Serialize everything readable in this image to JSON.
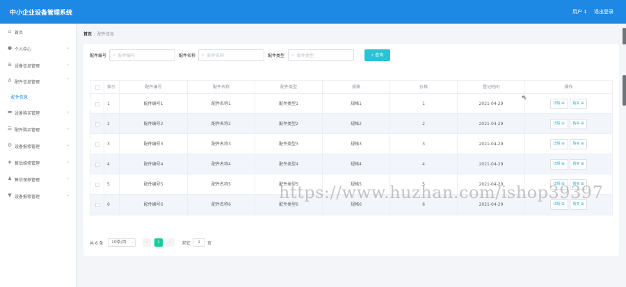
{
  "header": {
    "app_title": "中小企业设备管理系统",
    "user_label": "用户 1",
    "logout_label": "退出登录",
    "brand_color": "#1e88e5"
  },
  "sidebar": {
    "items": [
      {
        "label": "首页",
        "icon": "home-icon",
        "has_children": false
      },
      {
        "label": "个人中心",
        "icon": "user-icon",
        "has_children": true
      },
      {
        "label": "设备信息管理",
        "icon": "list-icon",
        "has_children": true
      },
      {
        "label": "配件信息管理",
        "icon": "bulb-icon",
        "has_children": true
      },
      {
        "label": "设备购买管理",
        "icon": "card-icon",
        "has_children": true
      },
      {
        "label": "配件购买管理",
        "icon": "menu-icon",
        "has_children": true
      },
      {
        "label": "设备报修管理",
        "icon": "gear-icon",
        "has_children": true
      },
      {
        "label": "售后维修管理",
        "icon": "shield-icon",
        "has_children": true
      },
      {
        "label": "售后保养管理",
        "icon": "person-icon",
        "has_children": true
      },
      {
        "label": "设备报修管理",
        "icon": "folder-icon",
        "has_children": true
      }
    ],
    "active_sub": "配件信息"
  },
  "breadcrumb": {
    "home": "首页",
    "separator": "/",
    "current": "配件信息"
  },
  "search": {
    "fields": [
      {
        "label": "配件编号",
        "placeholder": "配件编号",
        "value": ""
      },
      {
        "label": "配件名称",
        "placeholder": "配件名称",
        "value": ""
      },
      {
        "label": "配件类型",
        "placeholder": "配件类型",
        "value": ""
      }
    ],
    "query_label": "查询",
    "query_color": "#29c3d4"
  },
  "table": {
    "columns": [
      "索引",
      "配件编号",
      "配件名称",
      "配件类型",
      "规格",
      "价格",
      "登记时间",
      "操作"
    ],
    "rows": [
      {
        "index": "1",
        "code": "配件编号1",
        "name": "配件名称1",
        "type": "配件类型1",
        "spec": "规格1",
        "price": "1",
        "date": "2021-04-29"
      },
      {
        "index": "2",
        "code": "配件编号2",
        "name": "配件名称2",
        "type": "配件类型2",
        "spec": "规格2",
        "price": "2",
        "date": "2021-04-29"
      },
      {
        "index": "3",
        "code": "配件编号3",
        "name": "配件名称3",
        "type": "配件类型3",
        "spec": "规格3",
        "price": "3",
        "date": "2021-04-29"
      },
      {
        "index": "4",
        "code": "配件编号4",
        "name": "配件名称4",
        "type": "配件类型4",
        "spec": "规格4",
        "price": "4",
        "date": "2021-04-29"
      },
      {
        "index": "5",
        "code": "配件编号5",
        "name": "配件名称5",
        "type": "配件类型5",
        "spec": "规格5",
        "price": "5",
        "date": "2021-04-29"
      },
      {
        "index": "6",
        "code": "配件编号6",
        "name": "配件名称6",
        "type": "配件类型6",
        "spec": "规格6",
        "price": "6",
        "date": "2021-04-29"
      }
    ],
    "actions": {
      "detail": "详情 ⊞",
      "buy": "购买 ⊞"
    }
  },
  "pagination": {
    "total_label": "共 6 条",
    "page_size": "10条/页",
    "current_page": "1",
    "goto_prefix": "前往",
    "goto_value": "1",
    "goto_suffix": "页",
    "active_color": "#13ce9c"
  },
  "watermark": "https://www.huzhan.com/ishop39397"
}
